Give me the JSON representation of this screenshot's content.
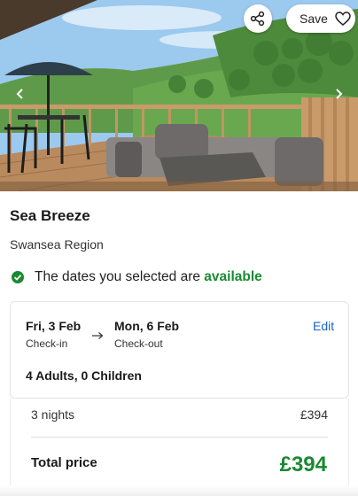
{
  "hero": {
    "image_name": "balcony-sea-view-photo",
    "save_label": "Save",
    "share_icon": "share-icon",
    "save_icon": "heart-icon"
  },
  "property": {
    "name": "Sea Breeze",
    "region": "Swansea Region"
  },
  "availability": {
    "text_prefix": "The dates you selected are",
    "status": "available",
    "status_color": "#1a8a32"
  },
  "booking": {
    "checkin_date": "Fri, 3 Feb",
    "checkin_label": "Check-in",
    "checkout_date": "Mon, 6 Feb",
    "checkout_label": "Check-out",
    "edit_label": "Edit",
    "guests": "4 Adults, 0 Children"
  },
  "pricing": {
    "nights_label": "3 nights",
    "nights_price": "£394",
    "total_label": "Total price",
    "total_price": "£394",
    "total_color": "#1a8a32"
  },
  "colors": {
    "link": "#1a64c8",
    "success": "#1a8a32"
  }
}
